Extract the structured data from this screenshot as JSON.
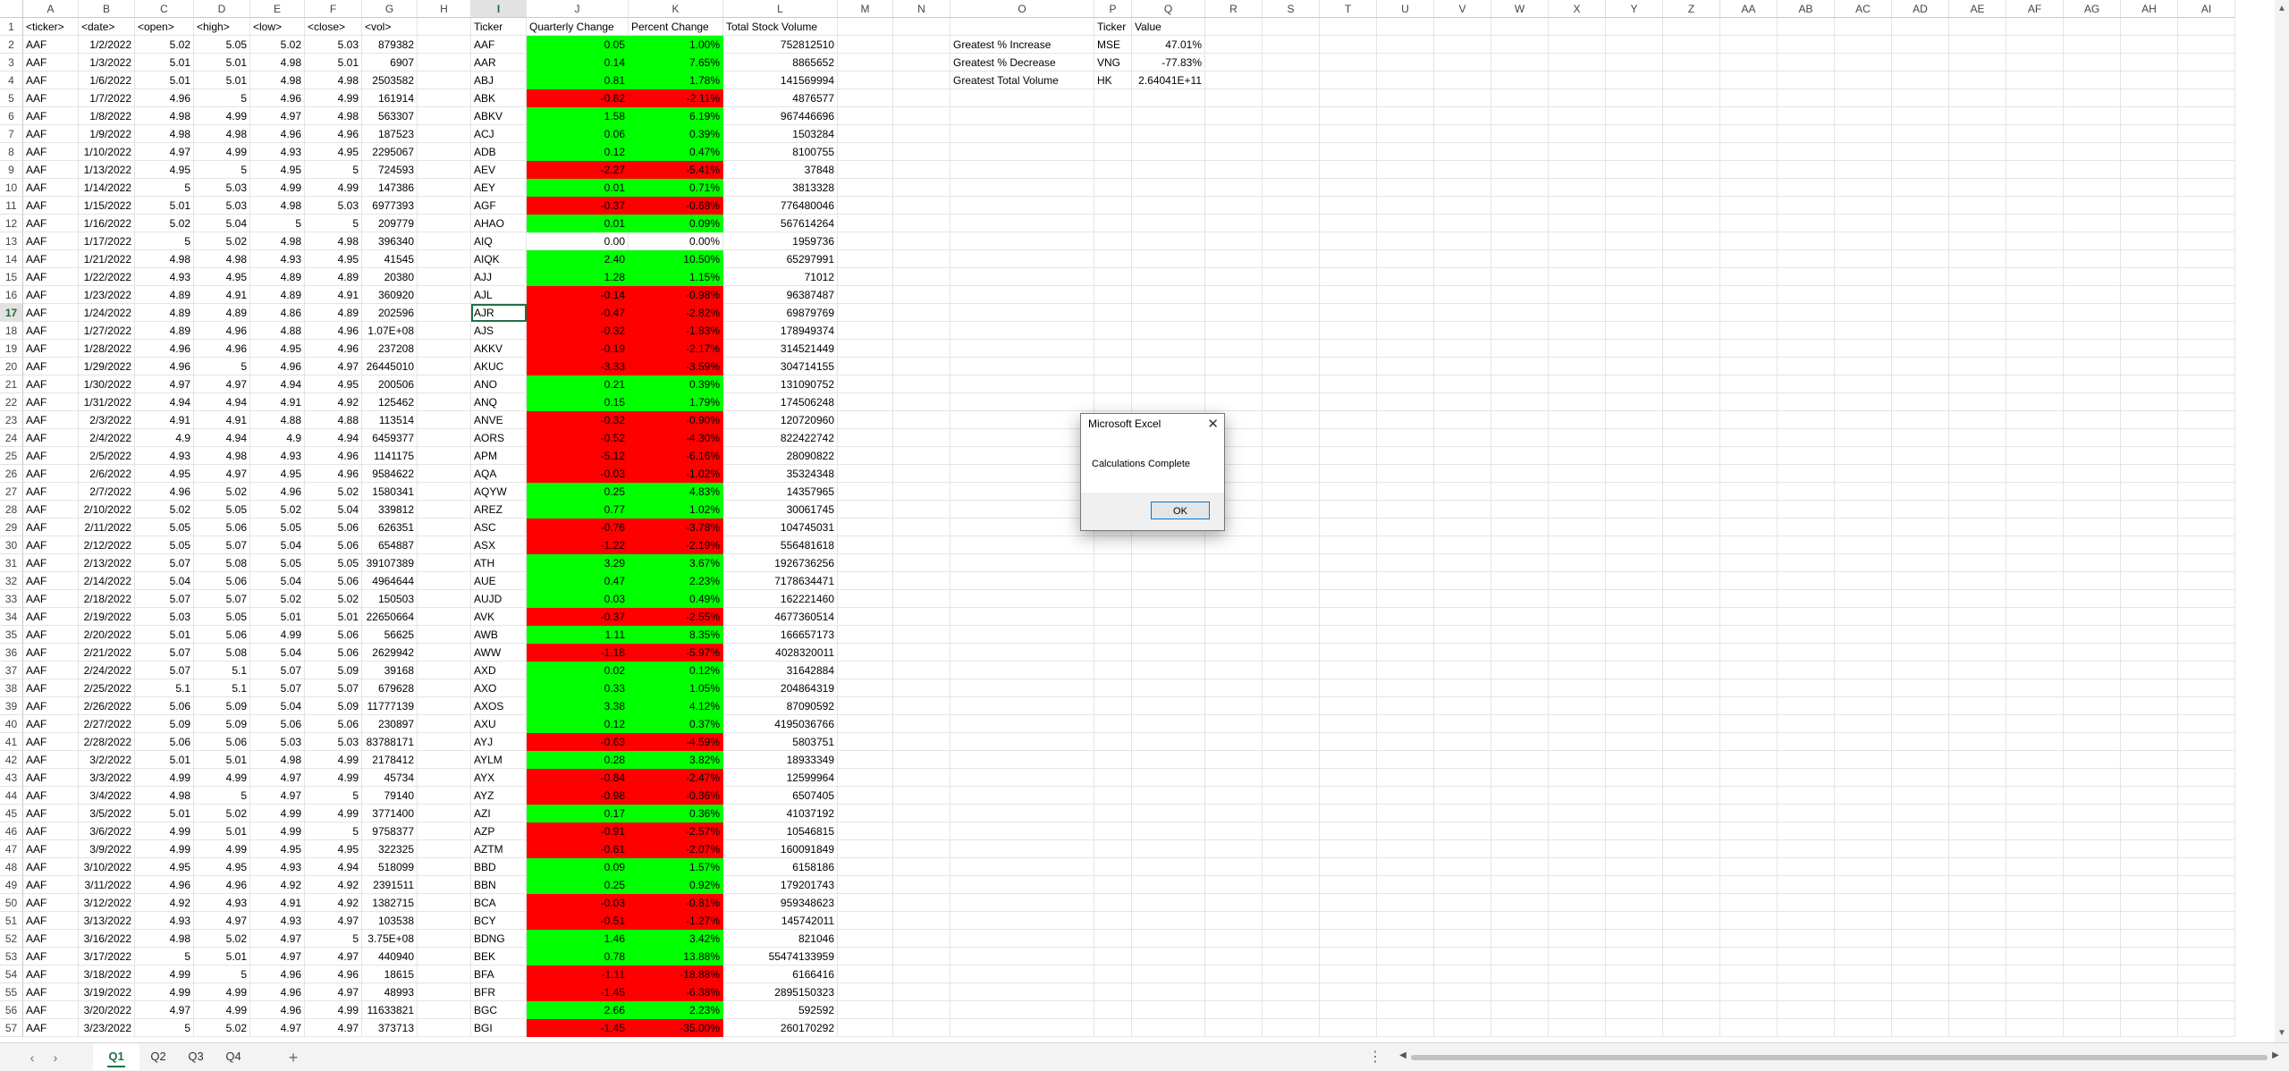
{
  "colors": {
    "positive": "#00ff00",
    "negative": "#ff0000",
    "accent": "#1e7145"
  },
  "active_cell": "I17",
  "columns": [
    "A",
    "B",
    "C",
    "D",
    "E",
    "F",
    "G",
    "H",
    "I",
    "J",
    "K",
    "L",
    "M",
    "N",
    "O",
    "P",
    "Q",
    "R",
    "S",
    "T",
    "U",
    "V",
    "W",
    "X",
    "Y",
    "Z",
    "AA",
    "AB",
    "AC",
    "AD",
    "AE",
    "AF",
    "AG",
    "AH",
    "AI"
  ],
  "headers": {
    "raw": [
      "<ticker>",
      "<date>",
      "<open>",
      "<high>",
      "<low>",
      "<close>",
      "<vol>"
    ],
    "summary": [
      "Ticker",
      "Quarterly Change",
      "Percent Change",
      "Total Stock Volume"
    ],
    "greatest": [
      "Ticker",
      "Value"
    ]
  },
  "raw_rows": [
    [
      "AAF",
      "1/2/2022",
      "5.02",
      "5.05",
      "5.02",
      "5.03",
      "879382"
    ],
    [
      "AAF",
      "1/3/2022",
      "5.01",
      "5.01",
      "4.98",
      "5.01",
      "6907"
    ],
    [
      "AAF",
      "1/6/2022",
      "5.01",
      "5.01",
      "4.98",
      "4.98",
      "2503582"
    ],
    [
      "AAF",
      "1/7/2022",
      "4.96",
      "5",
      "4.96",
      "4.99",
      "161914"
    ],
    [
      "AAF",
      "1/8/2022",
      "4.98",
      "4.99",
      "4.97",
      "4.98",
      "563307"
    ],
    [
      "AAF",
      "1/9/2022",
      "4.98",
      "4.98",
      "4.96",
      "4.96",
      "187523"
    ],
    [
      "AAF",
      "1/10/2022",
      "4.97",
      "4.99",
      "4.93",
      "4.95",
      "2295067"
    ],
    [
      "AAF",
      "1/13/2022",
      "4.95",
      "5",
      "4.95",
      "5",
      "724593"
    ],
    [
      "AAF",
      "1/14/2022",
      "5",
      "5.03",
      "4.99",
      "4.99",
      "147386"
    ],
    [
      "AAF",
      "1/15/2022",
      "5.01",
      "5.03",
      "4.98",
      "5.03",
      "6977393"
    ],
    [
      "AAF",
      "1/16/2022",
      "5.02",
      "5.04",
      "5",
      "5",
      "209779"
    ],
    [
      "AAF",
      "1/17/2022",
      "5",
      "5.02",
      "4.98",
      "4.98",
      "396340"
    ],
    [
      "AAF",
      "1/21/2022",
      "4.98",
      "4.98",
      "4.93",
      "4.95",
      "41545"
    ],
    [
      "AAF",
      "1/22/2022",
      "4.93",
      "4.95",
      "4.89",
      "4.89",
      "20380"
    ],
    [
      "AAF",
      "1/23/2022",
      "4.89",
      "4.91",
      "4.89",
      "4.91",
      "360920"
    ],
    [
      "AAF",
      "1/24/2022",
      "4.89",
      "4.89",
      "4.86",
      "4.89",
      "202596"
    ],
    [
      "AAF",
      "1/27/2022",
      "4.89",
      "4.96",
      "4.88",
      "4.96",
      "1.07E+08"
    ],
    [
      "AAF",
      "1/28/2022",
      "4.96",
      "4.96",
      "4.95",
      "4.96",
      "237208"
    ],
    [
      "AAF",
      "1/29/2022",
      "4.96",
      "5",
      "4.96",
      "4.97",
      "26445010"
    ],
    [
      "AAF",
      "1/30/2022",
      "4.97",
      "4.97",
      "4.94",
      "4.95",
      "200506"
    ],
    [
      "AAF",
      "1/31/2022",
      "4.94",
      "4.94",
      "4.91",
      "4.92",
      "125462"
    ],
    [
      "AAF",
      "2/3/2022",
      "4.91",
      "4.91",
      "4.88",
      "4.88",
      "113514"
    ],
    [
      "AAF",
      "2/4/2022",
      "4.9",
      "4.94",
      "4.9",
      "4.94",
      "6459377"
    ],
    [
      "AAF",
      "2/5/2022",
      "4.93",
      "4.98",
      "4.93",
      "4.96",
      "1141175"
    ],
    [
      "AAF",
      "2/6/2022",
      "4.95",
      "4.97",
      "4.95",
      "4.96",
      "9584622"
    ],
    [
      "AAF",
      "2/7/2022",
      "4.96",
      "5.02",
      "4.96",
      "5.02",
      "1580341"
    ],
    [
      "AAF",
      "2/10/2022",
      "5.02",
      "5.05",
      "5.02",
      "5.04",
      "339812"
    ],
    [
      "AAF",
      "2/11/2022",
      "5.05",
      "5.06",
      "5.05",
      "5.06",
      "626351"
    ],
    [
      "AAF",
      "2/12/2022",
      "5.05",
      "5.07",
      "5.04",
      "5.06",
      "654887"
    ],
    [
      "AAF",
      "2/13/2022",
      "5.07",
      "5.08",
      "5.05",
      "5.05",
      "39107389"
    ],
    [
      "AAF",
      "2/14/2022",
      "5.04",
      "5.06",
      "5.04",
      "5.06",
      "4964644"
    ],
    [
      "AAF",
      "2/18/2022",
      "5.07",
      "5.07",
      "5.02",
      "5.02",
      "150503"
    ],
    [
      "AAF",
      "2/19/2022",
      "5.03",
      "5.05",
      "5.01",
      "5.01",
      "22650664"
    ],
    [
      "AAF",
      "2/20/2022",
      "5.01",
      "5.06",
      "4.99",
      "5.06",
      "56625"
    ],
    [
      "AAF",
      "2/21/2022",
      "5.07",
      "5.08",
      "5.04",
      "5.06",
      "2629942"
    ],
    [
      "AAF",
      "2/24/2022",
      "5.07",
      "5.1",
      "5.07",
      "5.09",
      "39168"
    ],
    [
      "AAF",
      "2/25/2022",
      "5.1",
      "5.1",
      "5.07",
      "5.07",
      "679628"
    ],
    [
      "AAF",
      "2/26/2022",
      "5.06",
      "5.09",
      "5.04",
      "5.09",
      "11777139"
    ],
    [
      "AAF",
      "2/27/2022",
      "5.09",
      "5.09",
      "5.06",
      "5.06",
      "230897"
    ],
    [
      "AAF",
      "2/28/2022",
      "5.06",
      "5.06",
      "5.03",
      "5.03",
      "83788171"
    ],
    [
      "AAF",
      "3/2/2022",
      "5.01",
      "5.01",
      "4.98",
      "4.99",
      "2178412"
    ],
    [
      "AAF",
      "3/3/2022",
      "4.99",
      "4.99",
      "4.97",
      "4.99",
      "45734"
    ],
    [
      "AAF",
      "3/4/2022",
      "4.98",
      "5",
      "4.97",
      "5",
      "79140"
    ],
    [
      "AAF",
      "3/5/2022",
      "5.01",
      "5.02",
      "4.99",
      "4.99",
      "3771400"
    ],
    [
      "AAF",
      "3/6/2022",
      "4.99",
      "5.01",
      "4.99",
      "5",
      "9758377"
    ],
    [
      "AAF",
      "3/9/2022",
      "4.99",
      "4.99",
      "4.95",
      "4.95",
      "322325"
    ],
    [
      "AAF",
      "3/10/2022",
      "4.95",
      "4.95",
      "4.93",
      "4.94",
      "518099"
    ],
    [
      "AAF",
      "3/11/2022",
      "4.96",
      "4.96",
      "4.92",
      "4.92",
      "2391511"
    ],
    [
      "AAF",
      "3/12/2022",
      "4.92",
      "4.93",
      "4.91",
      "4.92",
      "1382715"
    ],
    [
      "AAF",
      "3/13/2022",
      "4.93",
      "4.97",
      "4.93",
      "4.97",
      "103538"
    ],
    [
      "AAF",
      "3/16/2022",
      "4.98",
      "5.02",
      "4.97",
      "5",
      "3.75E+08"
    ],
    [
      "AAF",
      "3/17/2022",
      "5",
      "5.01",
      "4.97",
      "4.97",
      "440940"
    ],
    [
      "AAF",
      "3/18/2022",
      "4.99",
      "5",
      "4.96",
      "4.96",
      "18615"
    ],
    [
      "AAF",
      "3/19/2022",
      "4.99",
      "4.99",
      "4.96",
      "4.97",
      "48993"
    ],
    [
      "AAF",
      "3/20/2022",
      "4.97",
      "4.99",
      "4.96",
      "4.99",
      "11633821"
    ],
    [
      "AAF",
      "3/23/2022",
      "5",
      "5.02",
      "4.97",
      "4.97",
      "373713"
    ]
  ],
  "summary_rows": [
    [
      "AAF",
      "0.05",
      "1.00%",
      "752812510"
    ],
    [
      "AAR",
      "0.14",
      "7.65%",
      "8865652"
    ],
    [
      "ABJ",
      "0.81",
      "1.78%",
      "141569994"
    ],
    [
      "ABK",
      "-0.82",
      "-2.11%",
      "4876577"
    ],
    [
      "ABKV",
      "1.58",
      "6.19%",
      "967446696"
    ],
    [
      "ACJ",
      "0.06",
      "0.39%",
      "1503284"
    ],
    [
      "ADB",
      "0.12",
      "0.47%",
      "8100755"
    ],
    [
      "AEV",
      "-2.27",
      "-5.41%",
      "37848"
    ],
    [
      "AEY",
      "0.01",
      "0.71%",
      "3813328"
    ],
    [
      "AGF",
      "-0.37",
      "-0.68%",
      "776480046"
    ],
    [
      "AHAO",
      "0.01",
      "0.09%",
      "567614264"
    ],
    [
      "AIQ",
      "0.00",
      "0.00%",
      "1959736"
    ],
    [
      "AIQK",
      "2.40",
      "10.50%",
      "65297991"
    ],
    [
      "AJJ",
      "1.28",
      "1.15%",
      "71012"
    ],
    [
      "AJL",
      "-0.14",
      "-0.98%",
      "96387487"
    ],
    [
      "AJR",
      "-0.47",
      "-2.82%",
      "69879769"
    ],
    [
      "AJS",
      "-0.32",
      "-1.83%",
      "178949374"
    ],
    [
      "AKKV",
      "-0.19",
      "-2.17%",
      "314521449"
    ],
    [
      "AKUC",
      "-3.33",
      "-3.59%",
      "304714155"
    ],
    [
      "ANO",
      "0.21",
      "0.39%",
      "131090752"
    ],
    [
      "ANQ",
      "0.15",
      "1.79%",
      "174506248"
    ],
    [
      "ANVE",
      "-0.32",
      "-0.90%",
      "120720960"
    ],
    [
      "AORS",
      "-0.52",
      "-4.30%",
      "822422742"
    ],
    [
      "APM",
      "-5.12",
      "-6.16%",
      "28090822"
    ],
    [
      "AQA",
      "-0.03",
      "-1.02%",
      "35324348"
    ],
    [
      "AQYW",
      "0.25",
      "4.83%",
      "14357965"
    ],
    [
      "AREZ",
      "0.77",
      "1.02%",
      "30061745"
    ],
    [
      "ASC",
      "-0.76",
      "-3.78%",
      "104745031"
    ],
    [
      "ASX",
      "-1.22",
      "-2.19%",
      "556481618"
    ],
    [
      "ATH",
      "3.29",
      "3.67%",
      "1926736256"
    ],
    [
      "AUE",
      "0.47",
      "2.23%",
      "7178634471"
    ],
    [
      "AUJD",
      "0.03",
      "0.49%",
      "162221460"
    ],
    [
      "AVK",
      "-0.37",
      "-2.55%",
      "4677360514"
    ],
    [
      "AWB",
      "1.11",
      "8.35%",
      "166657173"
    ],
    [
      "AWW",
      "-1.18",
      "-5.97%",
      "4028320011"
    ],
    [
      "AXD",
      "0.02",
      "0.12%",
      "31642884"
    ],
    [
      "AXO",
      "0.33",
      "1.05%",
      "204864319"
    ],
    [
      "AXOS",
      "3.38",
      "4.12%",
      "87090592"
    ],
    [
      "AXU",
      "0.12",
      "0.37%",
      "4195036766"
    ],
    [
      "AYJ",
      "-0.63",
      "-4.59%",
      "5803751"
    ],
    [
      "AYLM",
      "0.28",
      "3.82%",
      "18933349"
    ],
    [
      "AYX",
      "-0.84",
      "-2.47%",
      "12599964"
    ],
    [
      "AYZ",
      "-0.98",
      "-0.36%",
      "6507405"
    ],
    [
      "AZI",
      "0.17",
      "0.36%",
      "41037192"
    ],
    [
      "AZP",
      "-0.91",
      "-2.57%",
      "10546815"
    ],
    [
      "AZTM",
      "-0.61",
      "-2.07%",
      "160091849"
    ],
    [
      "BBD",
      "0.09",
      "1.57%",
      "6158186"
    ],
    [
      "BBN",
      "0.25",
      "0.92%",
      "179201743"
    ],
    [
      "BCA",
      "-0.03",
      "-0.81%",
      "959348623"
    ],
    [
      "BCY",
      "-0.51",
      "-1.27%",
      "145742011"
    ],
    [
      "BDNG",
      "1.46",
      "3.42%",
      "821046"
    ],
    [
      "BEK",
      "0.78",
      "13.88%",
      "55474133959"
    ],
    [
      "BFA",
      "-1.11",
      "-18.88%",
      "6166416"
    ],
    [
      "BFR",
      "-1.45",
      "-6.38%",
      "2895150323"
    ],
    [
      "BGC",
      "2.66",
      "2.23%",
      "592592"
    ],
    [
      "BGI",
      "-1.45",
      "-35.00%",
      "260170292"
    ]
  ],
  "greatest": [
    [
      "Greatest % Increase",
      "MSE",
      "47.01%"
    ],
    [
      "Greatest % Decrease",
      "VNG",
      "-77.83%"
    ],
    [
      "Greatest Total Volume",
      "HK",
      "2.64041E+11"
    ]
  ],
  "sheet_tabs": [
    "Q1",
    "Q2",
    "Q3",
    "Q4"
  ],
  "active_tab": "Q1",
  "dialog": {
    "title": "Microsoft Excel",
    "message": "Calculations Complete",
    "ok": "OK"
  },
  "icons": {
    "add_sheet": "plus-icon",
    "close": "close-icon",
    "nav_prev": "chevron-left-icon",
    "nav_next": "chevron-right-icon"
  }
}
